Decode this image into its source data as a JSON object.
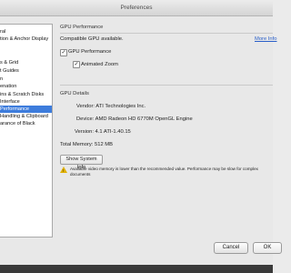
{
  "window": {
    "title": "Preferences"
  },
  "sidebar": {
    "items": [
      {
        "label": "ral"
      },
      {
        "label": "tion & Anchor Display"
      },
      {
        "label": ""
      },
      {
        "label": "s & Grid"
      },
      {
        "label": "t Guides"
      },
      {
        "label": "n"
      },
      {
        "label": "enation"
      },
      {
        "label": "ins & Scratch Disks"
      },
      {
        "label": "Interface"
      },
      {
        "label": "Performance"
      },
      {
        "label": "Handling & Clipboard"
      },
      {
        "label": "arance of Black"
      }
    ],
    "selected_index": 9
  },
  "gpu_performance": {
    "heading": "GPU Performance",
    "compatible_text": "Compatible GPU available.",
    "more_info_link": "More Info",
    "gpu_checkbox": {
      "label": "GPU Performance",
      "checked": true
    },
    "animated_zoom_checkbox": {
      "label": "Animated Zoom",
      "checked": true
    }
  },
  "gpu_details": {
    "heading": "GPU Details",
    "vendor": "Vendor: ATI Technologies Inc.",
    "device": "Device: AMD Radeon HD 6770M OpenGL Engine",
    "version": "Version: 4.1 ATI-1.40.15",
    "total_memory": "Total Memory: 512 MB",
    "system_info_button": "Show System Info",
    "warning_line1": "Available video memory is lower than the recommended value. Performance may be slow for complex",
    "warning_line2": "documents"
  },
  "footer": {
    "cancel_label": "Cancel",
    "ok_label": "OK"
  }
}
